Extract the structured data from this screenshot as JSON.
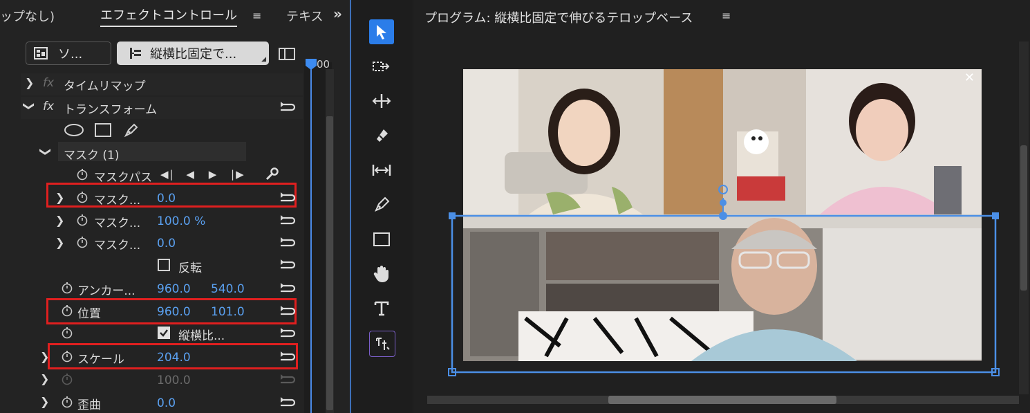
{
  "left_panel": {
    "tab_prev": "ップなし)",
    "tab_effect": "エフェクトコントロール",
    "tab_next": "テキス",
    "overflow": "»",
    "menu": "≡",
    "source_label": "ソ...",
    "clip_label": "縦横比固定で...",
    "timecode": "00"
  },
  "rows": {
    "timeremap": "タイムリマップ",
    "transform": "トランスフォーム",
    "mask_group": "マスク (1)",
    "mask_path": "マスクパス",
    "mask_feather_label": "マスク...",
    "mask_feather_value": "0.0",
    "mask_opacity_label": "マスク...",
    "mask_opacity_value": "100.0 %",
    "mask_expansion_label": "マスク...",
    "mask_expansion_value": "0.0",
    "invert_label": "反転",
    "anchor_label": "アンカー...",
    "anchor_x": "960.0",
    "anchor_y": "540.0",
    "position_label": "位置",
    "position_x": "960.0",
    "position_y": "101.0",
    "uniform_scale_label": "縦横比...",
    "scale_label": "スケール",
    "scale_value": "204.0",
    "scale_width_value": "100.0",
    "skew_label": "歪曲",
    "skew_value": "0.0"
  },
  "program": {
    "title": "プログラム: 縦横比固定で伸びるテロップベース",
    "menu": "≡",
    "close_glyph": "✕"
  },
  "colors": {
    "accent": "#3d8bf0",
    "value_blue": "#5aa0f0",
    "highlight_red": "#e01f1f",
    "panel_bg": "#232323"
  }
}
